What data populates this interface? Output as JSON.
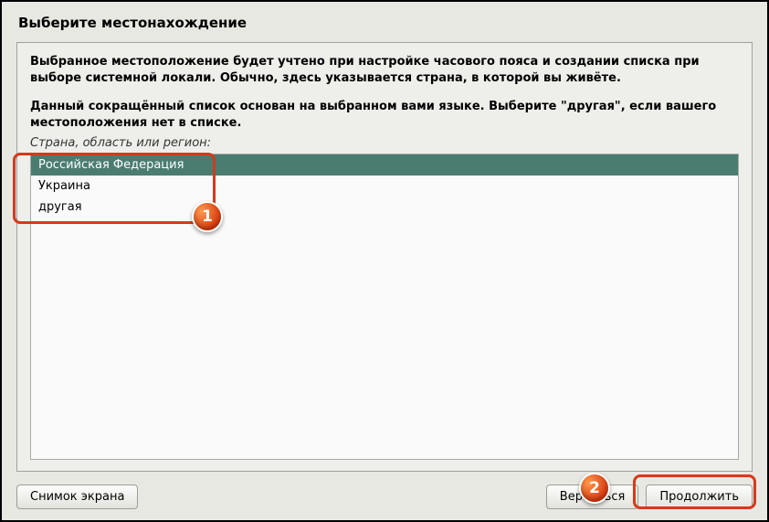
{
  "title": "Выберите местонахождение",
  "description1": "Выбранное местоположение будет учтено при настройке часового пояса и создании списка при выборе системной локали. Обычно, здесь указывается страна, в которой вы живёте.",
  "description2": "Данный сокращённый список основан на выбранном вами языке. Выберите \"другая\", если вашего местоположения нет в списке.",
  "list_label": "Страна, область или регион:",
  "items": [
    {
      "label": "Российская Федерация",
      "selected": true
    },
    {
      "label": "Украина",
      "selected": false
    },
    {
      "label": "другая",
      "selected": false
    }
  ],
  "buttons": {
    "screenshot": "Снимок экрана",
    "back": "Вернуться",
    "continue": "Продолжить"
  },
  "annotations": {
    "badge1": "1",
    "badge2": "2"
  }
}
